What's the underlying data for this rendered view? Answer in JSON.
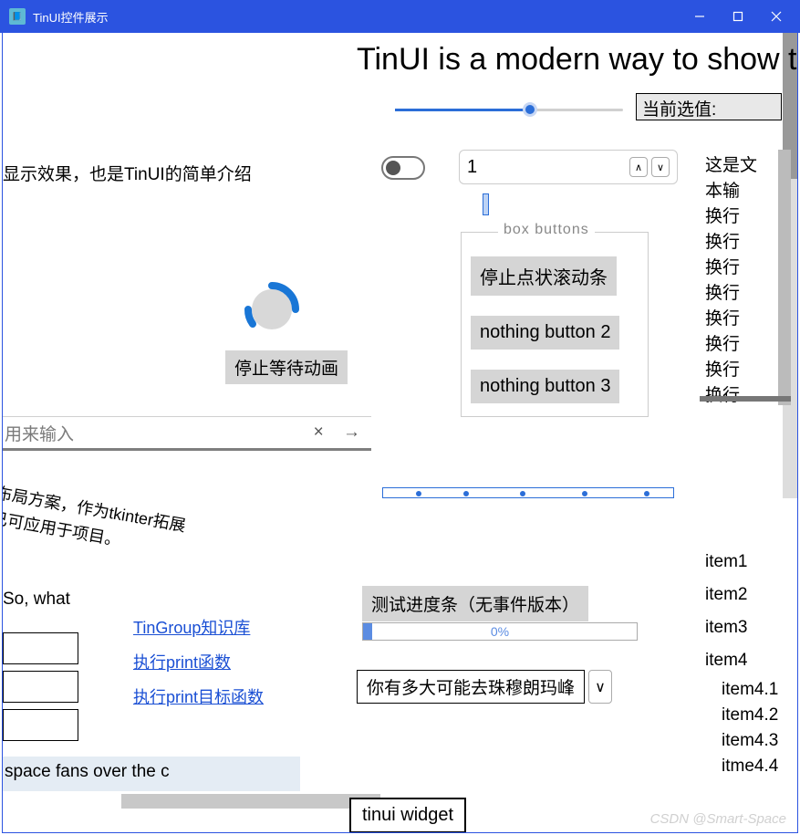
{
  "window": {
    "title": "TinUI控件展示"
  },
  "heading": "TinUI is a modern way to show t",
  "slider": {
    "current_label": "当前选值:"
  },
  "intro_text": "显示效果，也是TinUI的简单介绍",
  "spinner": {
    "value": "1"
  },
  "textbox": {
    "lines": [
      "这是文本输",
      "换行",
      "换行",
      "换行",
      "换行",
      "换行",
      "换行",
      "换行",
      "换行"
    ]
  },
  "buttonbox": {
    "legend": "box buttons",
    "buttons": [
      "停止点状滚动条",
      "nothing button 2",
      "nothing button 3"
    ]
  },
  "wait": {
    "label": "停止等待动画"
  },
  "entry": {
    "placeholder": "用来输入"
  },
  "rotated": {
    "line1": "布局方案，作为tkinter拓展",
    "line2": "已可应用于项目。"
  },
  "sowhat": "So, what",
  "links": [
    "TinGroup知识库",
    "执行print函数",
    "执行print目标函数"
  ],
  "progress": {
    "label": "测试进度条（无事件版本）",
    "percent_text": "0%"
  },
  "combo": {
    "value": "你有多大可能去珠穆朗玛峰"
  },
  "tree": {
    "items": [
      "item1",
      "item2",
      "item3",
      "item4"
    ],
    "sub": [
      "item4.1",
      "item4.2",
      "item4.3",
      "itme4.4"
    ]
  },
  "marquee": "space fans over the c",
  "bottom_tag": "tinui widget",
  "watermark": "CSDN @Smart-Space",
  "icons": {
    "close": "×",
    "arrow": "→",
    "up": "∧",
    "down": "∨"
  }
}
